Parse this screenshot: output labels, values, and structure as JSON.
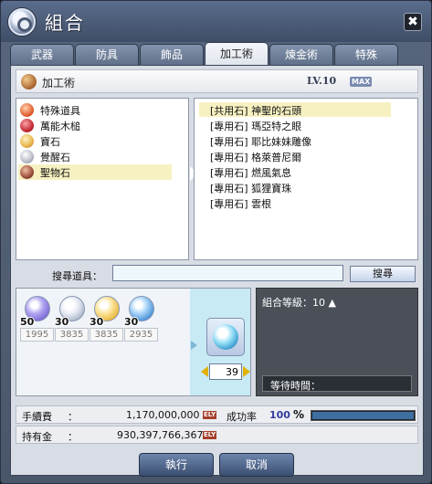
{
  "window": {
    "title": "組合",
    "close_label": "✖"
  },
  "tabs": [
    {
      "label": "武器"
    },
    {
      "label": "防具"
    },
    {
      "label": "飾品"
    },
    {
      "label": "加工術"
    },
    {
      "label": "煉金術"
    },
    {
      "label": "特殊"
    }
  ],
  "section": {
    "title": "加工術",
    "level": "LV.10",
    "max_badge": "MAX"
  },
  "categories": [
    {
      "label": "特殊道具",
      "icon": "special-item-icon",
      "color": "#e15a2b"
    },
    {
      "label": "萬能木槌",
      "icon": "mallet-icon",
      "color": "#c2242d"
    },
    {
      "label": "寶石",
      "icon": "gem-icon",
      "color": "#e8b54a"
    },
    {
      "label": "覺醒石",
      "icon": "awakening-stone-icon",
      "color": "#b8bcc7"
    },
    {
      "label": "聖物石",
      "icon": "relic-stone-icon",
      "color": "#9c4d3a"
    }
  ],
  "selected_category": "聖物石",
  "items": [
    {
      "label": "[共用石] 神聖的石頭"
    },
    {
      "label": "[專用石] 瑪亞特之眼"
    },
    {
      "label": "[專用石] 耶比妹妹雕像"
    },
    {
      "label": "[專用石] 格萊普尼爾"
    },
    {
      "label": "[專用石] 燃風氣息"
    },
    {
      "label": "[專用石] 狐狸寶珠"
    },
    {
      "label": "[專用石] 雲根"
    }
  ],
  "selected_item": "[共用石] 神聖的石頭",
  "search": {
    "label": "搜尋道具：",
    "value": "",
    "button_label": "搜尋"
  },
  "materials": [
    {
      "required": "50",
      "owned": "1995",
      "icon": "purple-gem-icon",
      "color": "#7e6bd6"
    },
    {
      "required": "30",
      "owned": "3835",
      "icon": "silver-gem-icon",
      "color": "#c9d2e2"
    },
    {
      "required": "30",
      "owned": "3835",
      "icon": "gold-gem-icon",
      "color": "#f0c64c"
    },
    {
      "required": "30",
      "owned": "2935",
      "icon": "blue-gem-icon",
      "color": "#5aa7e6"
    }
  ],
  "result": {
    "icon": "holy-stone-icon",
    "quantity": "39"
  },
  "info": {
    "combo_level": "組合等級：10 ▲",
    "wait_label": "等待時間："
  },
  "fee": {
    "label": "手續費",
    "colon": "：",
    "value": "1,170,000,000",
    "currency": "ELY"
  },
  "gold": {
    "label": "持有金",
    "colon": "：",
    "value": "930,397,766,367",
    "currency": "ELY"
  },
  "success": {
    "label": "成功率",
    "value": "100",
    "unit": "%",
    "fraction": 1.0
  },
  "buttons": {
    "execute_label": "執行",
    "cancel_label": "取消"
  },
  "colors": {
    "accent": "#3f6fa1",
    "selection": "#f7f1c2"
  }
}
